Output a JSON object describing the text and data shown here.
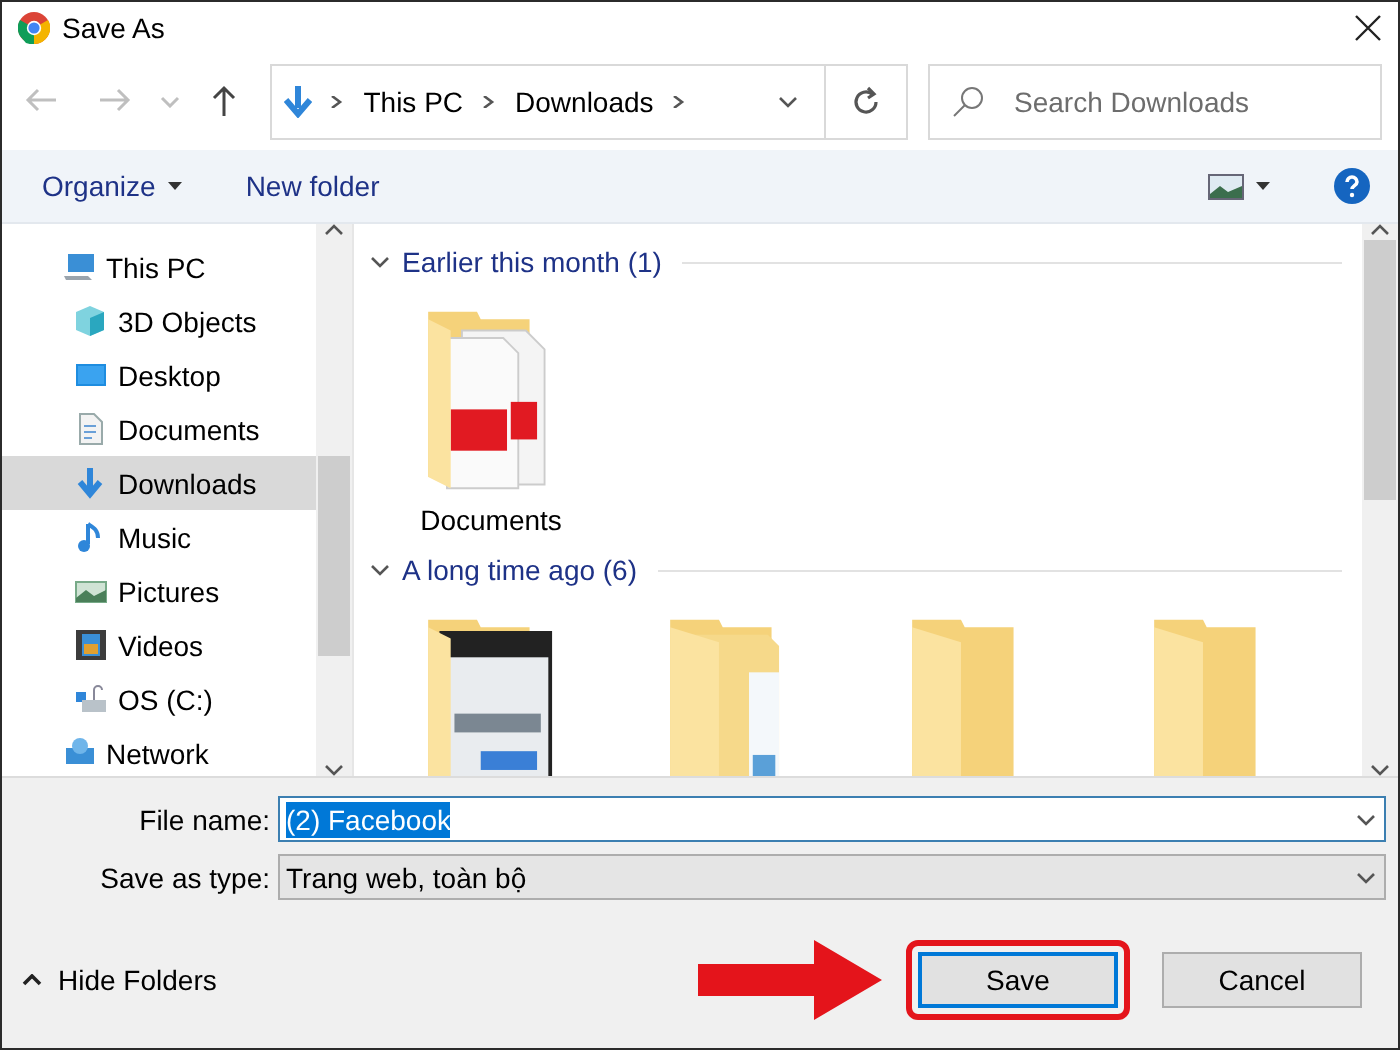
{
  "window": {
    "title": "Save As"
  },
  "nav_buttons": [
    {
      "kind": "back",
      "disabled": true
    },
    {
      "kind": "forward",
      "disabled": true
    },
    {
      "kind": "recent",
      "disabled": true
    },
    {
      "kind": "up",
      "disabled": false
    }
  ],
  "address": {
    "segments": [
      "This PC",
      "Downloads"
    ]
  },
  "search": {
    "placeholder": "Search Downloads"
  },
  "toolbar": {
    "organize": "Organize",
    "new_folder": "New folder"
  },
  "sidebar": {
    "items": [
      {
        "label": "This PC",
        "kind": "pc",
        "selected": false,
        "children": [
          {
            "label": "3D Objects",
            "kind": "cube",
            "selected": false
          },
          {
            "label": "Desktop",
            "kind": "desktop",
            "selected": false
          },
          {
            "label": "Documents",
            "kind": "document",
            "selected": false
          },
          {
            "label": "Downloads",
            "kind": "download",
            "selected": true
          },
          {
            "label": "Music",
            "kind": "music",
            "selected": false
          },
          {
            "label": "Pictures",
            "kind": "pictures",
            "selected": false
          },
          {
            "label": "Videos",
            "kind": "videos",
            "selected": false
          },
          {
            "label": "OS (C:)",
            "kind": "drive",
            "selected": false
          }
        ]
      },
      {
        "label": "Network",
        "kind": "network",
        "selected": false
      }
    ]
  },
  "groups": [
    {
      "title": "Earlier this month (1)",
      "expanded": true,
      "items": [
        {
          "label": "Documents",
          "kind": "pdf-folder"
        }
      ]
    },
    {
      "title": "A long time ago (6)",
      "expanded": true,
      "items": [
        {
          "kind": "picture-folder"
        },
        {
          "kind": "doc-folder"
        },
        {
          "kind": "folder"
        },
        {
          "kind": "folder"
        }
      ]
    }
  ],
  "file_name": {
    "label": "File name:",
    "value": "(2) Facebook",
    "selected": true
  },
  "save_type": {
    "label": "Save as type:",
    "value": "Trang web, toàn bộ"
  },
  "hide_folders": "Hide Folders",
  "buttons": [
    {
      "label": "Save",
      "kind": "primary",
      "highlighted": true
    },
    {
      "label": "Cancel",
      "kind": "secondary",
      "highlighted": false
    }
  ]
}
